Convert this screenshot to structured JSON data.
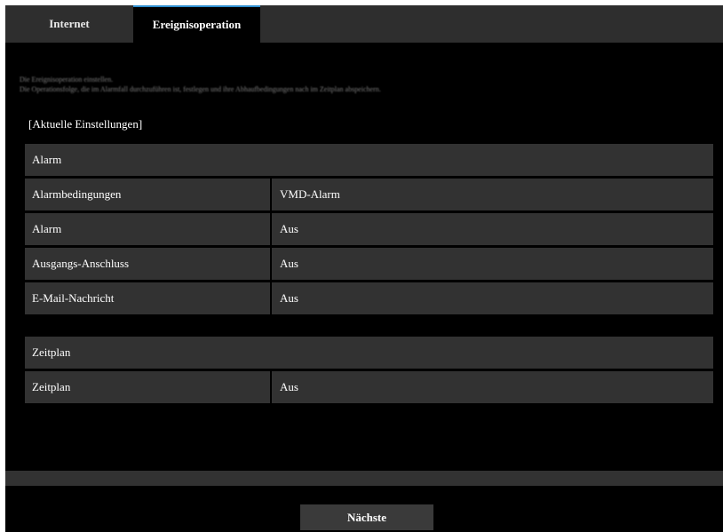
{
  "tabs": [
    {
      "label": "Internet",
      "active": false
    },
    {
      "label": "Ereignisoperation",
      "active": true
    }
  ],
  "description": {
    "line1": "Die Ereignisoperation einstellen.",
    "line2": "Die Operationsfolge, die im Alarmfall durchzuführen ist, festlegen und ihre Abhaufbedingungen nach im Zeitplan abspeichern."
  },
  "current_settings_heading": "[Aktuelle Einstellungen]",
  "alarm_section": {
    "title": "Alarm",
    "rows": [
      {
        "label": "Alarmbedingungen",
        "value": "VMD-Alarm"
      },
      {
        "label": "Alarm",
        "value": "Aus"
      },
      {
        "label": "Ausgangs-Anschluss",
        "value": "Aus"
      },
      {
        "label": "E-Mail-Nachricht",
        "value": "Aus"
      }
    ]
  },
  "schedule_section": {
    "title": "Zeitplan",
    "rows": [
      {
        "label": "Zeitplan",
        "value": "Aus"
      }
    ]
  },
  "next_button": "Nächste",
  "colors": {
    "background": "#000000",
    "row": "#323232",
    "tab_accent": "#2f8fd0",
    "tabbar": "#2e2e2e"
  }
}
